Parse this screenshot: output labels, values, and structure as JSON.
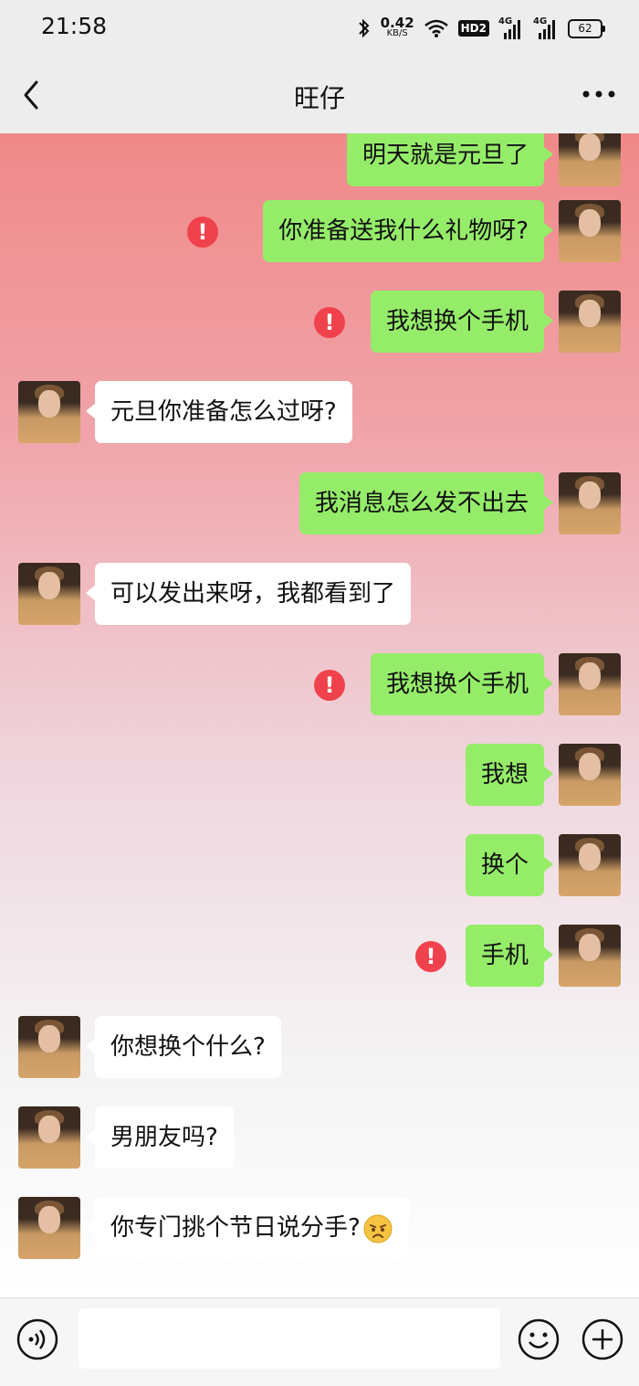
{
  "status_bar": {
    "time": "21:58",
    "net_speed_value": "0.42",
    "net_speed_unit": "KB/S",
    "hd_label": "HD2",
    "signal1_label": "4G",
    "signal2_label": "4G",
    "battery": "62"
  },
  "header": {
    "title": "旺仔",
    "back_icon": "chevron-left-icon",
    "more_icon": "more-dots-icon"
  },
  "messages": [
    {
      "side": "out",
      "text": "明天就是元旦了",
      "failed": false
    },
    {
      "side": "out",
      "text": "你准备送我什么礼物呀?",
      "failed": true
    },
    {
      "side": "out",
      "text": "我想换个手机",
      "failed": true
    },
    {
      "side": "in",
      "text": "元旦你准备怎么过呀?",
      "failed": false
    },
    {
      "side": "out",
      "text": "我消息怎么发不出去",
      "failed": false
    },
    {
      "side": "in",
      "text": "可以发出来呀，我都看到了",
      "failed": false
    },
    {
      "side": "out",
      "text": "我想换个手机",
      "failed": true
    },
    {
      "side": "out",
      "text": "我想",
      "failed": false
    },
    {
      "side": "out",
      "text": "换个",
      "failed": false
    },
    {
      "side": "out",
      "text": "手机",
      "failed": true
    },
    {
      "side": "in",
      "text": "你想换个什么?",
      "failed": false
    },
    {
      "side": "in",
      "text": "男朋友吗?",
      "failed": false
    },
    {
      "side": "in",
      "text": "你专门挑个节日说分手?",
      "failed": false,
      "emoji": "sad-face-emoji"
    }
  ],
  "error_mark": "!",
  "bottom_bar": {
    "input_value": "",
    "voice_icon": "voice-icon",
    "emoji_icon": "smiley-icon",
    "plus_icon": "plus-icon"
  },
  "colors": {
    "outgoing_bubble": "#95ec69",
    "incoming_bubble": "#ffffff",
    "error_badge": "#f0424d",
    "background_top": "#f08989"
  }
}
